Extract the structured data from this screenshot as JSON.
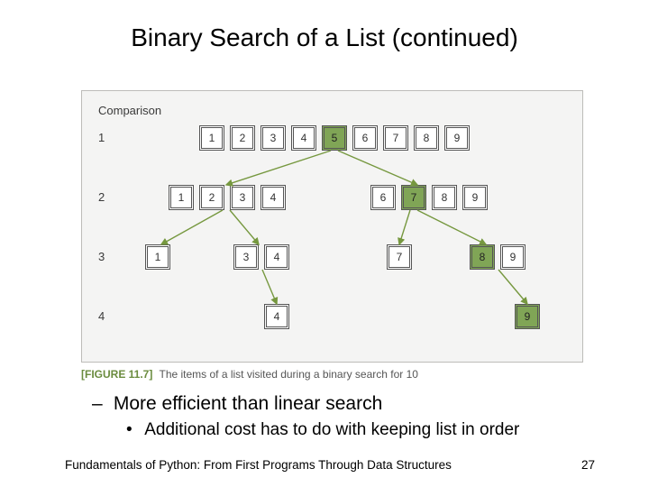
{
  "title": "Binary Search of a List (continued)",
  "figure": {
    "comparison_label": "Comparison",
    "row_labels": [
      "1",
      "2",
      "3",
      "4"
    ],
    "rows": [
      {
        "cells": [
          "1",
          "2",
          "3",
          "4",
          "5",
          "6",
          "7",
          "8",
          "9"
        ],
        "hl_index": 4
      },
      {
        "cells": [
          "1",
          "2",
          "3",
          "4",
          "",
          "6",
          "7",
          "8",
          "9"
        ],
        "hl_index": 6
      },
      {
        "cells": [
          "1",
          "",
          "3",
          "4",
          "",
          "",
          "7",
          "",
          "8",
          "9"
        ],
        "hl_index": 8
      },
      {
        "cells": [
          "",
          "",
          "",
          "4",
          "",
          "",
          "",
          "",
          "",
          "9"
        ],
        "hl_index": 9
      }
    ],
    "caption_tag": "[FIGURE 11.7]",
    "caption_text": "The items of a list visited during a binary search for 10"
  },
  "bullets": {
    "b1": "More efficient than linear search",
    "b2": "Additional cost has to do with keeping list in order"
  },
  "footer": "Fundamentals of Python: From First Programs Through Data Structures",
  "page_number": "27",
  "colors": {
    "highlight": "#80a556",
    "arrow": "#76983f"
  }
}
